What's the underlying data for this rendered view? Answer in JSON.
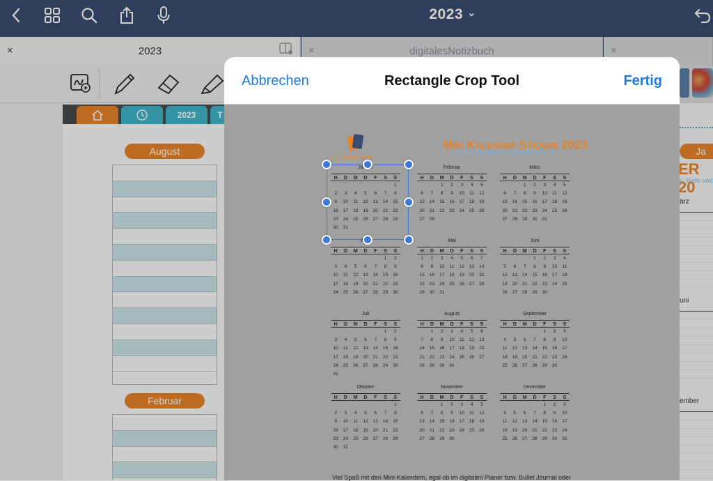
{
  "topbar": {
    "title": "2023",
    "title_chevron": "⌄",
    "icons": [
      "back-icon",
      "grid-icon",
      "search-icon",
      "share-icon",
      "microphone-icon",
      "undo-icon"
    ]
  },
  "tabs": [
    {
      "label": "2023",
      "close": "×",
      "active": true
    },
    {
      "label": "digitalesNotizbuch",
      "close": "×",
      "active": false
    },
    {
      "label": "",
      "close": "×",
      "active": false
    }
  ],
  "left_planner": {
    "nav": [
      "",
      "",
      "2023",
      "T"
    ],
    "months": [
      "August",
      "Februar"
    ]
  },
  "crop_modal": {
    "cancel": "Abbrechen",
    "title": "Rectangle Crop Tool",
    "done": "Fertig"
  },
  "sticker": {
    "title": "Mini Kalender Sticker 2023",
    "subtitle": "Für iPads für Goodnotes, Notability, Xodo usw.",
    "logo_text": "digitale planer.de",
    "weekdays": [
      "H",
      "D",
      "M",
      "D",
      "F",
      "S",
      "S"
    ],
    "months": [
      {
        "name": "Januar",
        "weeks": [
          [
            "",
            "",
            "",
            "",
            "",
            "",
            "1"
          ],
          [
            "2",
            "3",
            "4",
            "5",
            "6",
            "7",
            "8"
          ],
          [
            "9",
            "10",
            "11",
            "12",
            "13",
            "14",
            "15"
          ],
          [
            "16",
            "17",
            "18",
            "19",
            "20",
            "21",
            "22"
          ],
          [
            "23",
            "24",
            "25",
            "26",
            "27",
            "28",
            "29"
          ],
          [
            "30",
            "31",
            "",
            "",
            "",
            "",
            ""
          ]
        ]
      },
      {
        "name": "Februar",
        "weeks": [
          [
            "",
            "",
            "1",
            "2",
            "3",
            "4",
            "5"
          ],
          [
            "6",
            "7",
            "8",
            "9",
            "10",
            "11",
            "12"
          ],
          [
            "13",
            "14",
            "15",
            "16",
            "17",
            "18",
            "19"
          ],
          [
            "20",
            "21",
            "22",
            "23",
            "24",
            "25",
            "26"
          ],
          [
            "27",
            "28",
            "",
            "",
            "",
            "",
            ""
          ]
        ]
      },
      {
        "name": "März",
        "weeks": [
          [
            "",
            "",
            "1",
            "2",
            "3",
            "4",
            "5"
          ],
          [
            "6",
            "7",
            "8",
            "9",
            "10",
            "11",
            "12"
          ],
          [
            "13",
            "14",
            "15",
            "16",
            "17",
            "18",
            "19"
          ],
          [
            "20",
            "21",
            "22",
            "23",
            "24",
            "25",
            "26"
          ],
          [
            "27",
            "28",
            "29",
            "30",
            "31",
            "",
            ""
          ]
        ]
      },
      {
        "name": "April",
        "weeks": [
          [
            "",
            "",
            "",
            "",
            "",
            "1",
            "2"
          ],
          [
            "3",
            "4",
            "5",
            "6",
            "7",
            "8",
            "9"
          ],
          [
            "10",
            "11",
            "12",
            "13",
            "14",
            "15",
            "16"
          ],
          [
            "17",
            "18",
            "19",
            "20",
            "21",
            "22",
            "23"
          ],
          [
            "24",
            "25",
            "26",
            "27",
            "28",
            "29",
            "30"
          ]
        ]
      },
      {
        "name": "Mai",
        "weeks": [
          [
            "1",
            "2",
            "3",
            "4",
            "5",
            "6",
            "7"
          ],
          [
            "8",
            "9",
            "10",
            "11",
            "12",
            "13",
            "14"
          ],
          [
            "15",
            "16",
            "17",
            "18",
            "19",
            "20",
            "21"
          ],
          [
            "22",
            "23",
            "24",
            "25",
            "26",
            "27",
            "28"
          ],
          [
            "29",
            "30",
            "31",
            "",
            "",
            "",
            ""
          ]
        ]
      },
      {
        "name": "Juni",
        "weeks": [
          [
            "",
            "",
            "",
            "1",
            "2",
            "3",
            "4"
          ],
          [
            "5",
            "6",
            "7",
            "8",
            "9",
            "10",
            "11"
          ],
          [
            "12",
            "13",
            "14",
            "15",
            "16",
            "17",
            "18"
          ],
          [
            "19",
            "20",
            "21",
            "22",
            "23",
            "24",
            "25"
          ],
          [
            "26",
            "27",
            "28",
            "29",
            "30",
            "",
            ""
          ]
        ]
      },
      {
        "name": "Juli",
        "weeks": [
          [
            "",
            "",
            "",
            "",
            "",
            "1",
            "2"
          ],
          [
            "3",
            "4",
            "5",
            "6",
            "7",
            "8",
            "9"
          ],
          [
            "10",
            "11",
            "12",
            "13",
            "14",
            "15",
            "16"
          ],
          [
            "17",
            "18",
            "19",
            "20",
            "21",
            "22",
            "23"
          ],
          [
            "24",
            "25",
            "26",
            "27",
            "28",
            "29",
            "30"
          ],
          [
            "31",
            "",
            "",
            "",
            "",
            "",
            ""
          ]
        ]
      },
      {
        "name": "August",
        "weeks": [
          [
            "",
            "1",
            "2",
            "3",
            "4",
            "5",
            "6"
          ],
          [
            "7",
            "8",
            "9",
            "10",
            "11",
            "12",
            "13"
          ],
          [
            "14",
            "15",
            "16",
            "17",
            "18",
            "19",
            "20"
          ],
          [
            "21",
            "22",
            "23",
            "24",
            "25",
            "26",
            "27"
          ],
          [
            "28",
            "29",
            "30",
            "31",
            "",
            "",
            ""
          ]
        ]
      },
      {
        "name": "September",
        "weeks": [
          [
            "",
            "",
            "",
            "",
            "1",
            "2",
            "3"
          ],
          [
            "4",
            "5",
            "6",
            "7",
            "8",
            "9",
            "10"
          ],
          [
            "11",
            "12",
            "13",
            "14",
            "15",
            "16",
            "17"
          ],
          [
            "18",
            "19",
            "20",
            "21",
            "22",
            "23",
            "24"
          ],
          [
            "25",
            "26",
            "27",
            "28",
            "29",
            "30",
            ""
          ]
        ]
      },
      {
        "name": "Oktober",
        "weeks": [
          [
            "",
            "",
            "",
            "",
            "",
            "",
            "1"
          ],
          [
            "2",
            "3",
            "4",
            "5",
            "6",
            "7",
            "8"
          ],
          [
            "9",
            "10",
            "11",
            "12",
            "13",
            "14",
            "15"
          ],
          [
            "16",
            "17",
            "18",
            "19",
            "20",
            "21",
            "22"
          ],
          [
            "23",
            "24",
            "25",
            "26",
            "27",
            "28",
            "29"
          ],
          [
            "30",
            "31",
            "",
            "",
            "",
            "",
            ""
          ]
        ]
      },
      {
        "name": "November",
        "weeks": [
          [
            "",
            "",
            "1",
            "2",
            "3",
            "4",
            "5"
          ],
          [
            "6",
            "7",
            "8",
            "9",
            "10",
            "11",
            "12"
          ],
          [
            "13",
            "14",
            "15",
            "16",
            "17",
            "18",
            "19"
          ],
          [
            "20",
            "21",
            "22",
            "23",
            "24",
            "25",
            "26"
          ],
          [
            "27",
            "28",
            "29",
            "30",
            "",
            "",
            ""
          ]
        ]
      },
      {
        "name": "Dezember",
        "weeks": [
          [
            "",
            "",
            "",
            "",
            "1",
            "2",
            "3"
          ],
          [
            "4",
            "5",
            "6",
            "7",
            "8",
            "9",
            "10"
          ],
          [
            "11",
            "12",
            "13",
            "14",
            "15",
            "16",
            "17"
          ],
          [
            "18",
            "19",
            "20",
            "21",
            "22",
            "23",
            "24"
          ],
          [
            "25",
            "26",
            "27",
            "28",
            "29",
            "30",
            "31"
          ]
        ]
      }
    ],
    "footnote": "Viel Spaß mit den Mini-Kalendern, egal ob im digitalen Planer bzw. Bullet Journal oder"
  },
  "right_peek": {
    "title_fragment": "ER 20",
    "subtitle_fragment": "y, Xodo und",
    "pill_fragment": "Ja",
    "month_fragments": [
      "ärz",
      "uni",
      "ember"
    ]
  },
  "colors": {
    "topbar": "#3a4d6f",
    "accent_orange": "#e8842a",
    "link_blue": "#1f7ae0",
    "handle_blue": "#3b78d8"
  }
}
